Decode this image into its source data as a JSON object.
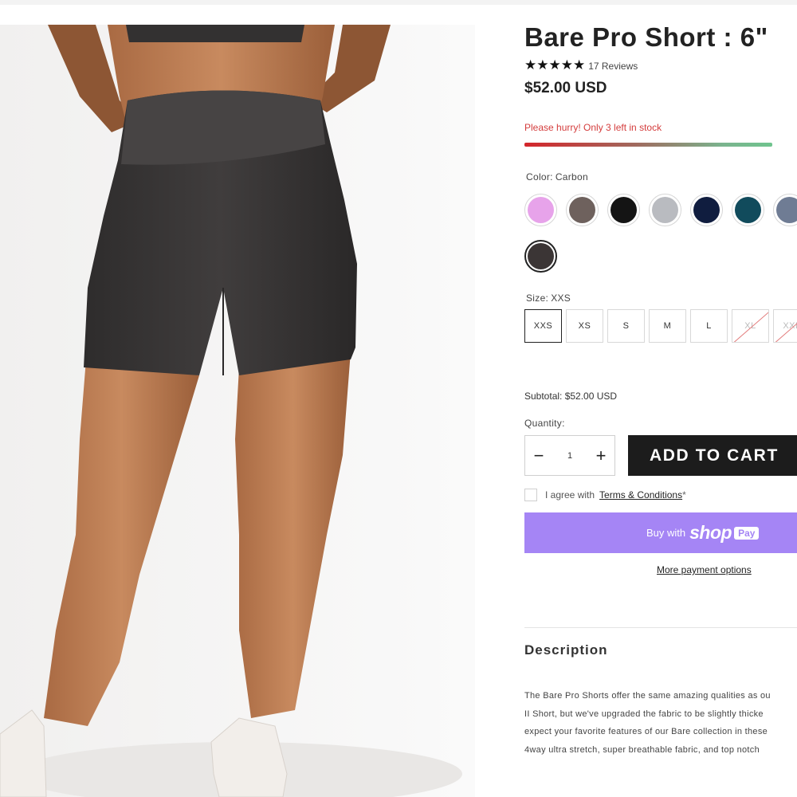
{
  "product": {
    "title": "Bare Pro Short : 6\"",
    "stars": "★★★★★",
    "reviews": "17 Reviews",
    "price": "$52.00 USD",
    "stock_message": "Please hurry! Only 3 left in stock",
    "stock_fraction": 0.6
  },
  "color": {
    "label": "Color:",
    "selected": "Carbon",
    "swatches": [
      {
        "name": "pink",
        "hex": "#e7a3ea"
      },
      {
        "name": "mocha",
        "hex": "#6e615d"
      },
      {
        "name": "black",
        "hex": "#141414"
      },
      {
        "name": "light-grey",
        "hex": "#b9bbc0"
      },
      {
        "name": "navy",
        "hex": "#101d3f"
      },
      {
        "name": "teal",
        "hex": "#114b5c"
      },
      {
        "name": "slate-blue",
        "hex": "#6f7c94"
      },
      {
        "name": "carbon",
        "hex": "#3b3535",
        "selected": true
      }
    ]
  },
  "size": {
    "label": "Size:",
    "selected": "XXS",
    "options": [
      {
        "label": "XXS",
        "selected": true,
        "sold_out": false
      },
      {
        "label": "XS",
        "selected": false,
        "sold_out": false
      },
      {
        "label": "S",
        "selected": false,
        "sold_out": false
      },
      {
        "label": "M",
        "selected": false,
        "sold_out": false
      },
      {
        "label": "L",
        "selected": false,
        "sold_out": false
      },
      {
        "label": "XL",
        "selected": false,
        "sold_out": true
      },
      {
        "label": "XXL",
        "selected": false,
        "sold_out": true
      }
    ]
  },
  "subtotal": "Subtotal: $52.00 USD",
  "quantity": {
    "label": "Quantity:",
    "value": "1",
    "minus": "−",
    "plus": "+"
  },
  "add_to_cart": "ADD TO CART",
  "agree": {
    "text": "I agree with",
    "terms": "Terms & Conditions",
    "asterisk": "*"
  },
  "shop_pay": {
    "buy_with": "Buy with",
    "brand": "shop",
    "pay": "Pay",
    "color": "#a585f5"
  },
  "more_payment": "More payment options",
  "description": {
    "title": "Description",
    "lines": [
      "The Bare Pro Shorts offer the same amazing qualities as ou",
      "II Short, but we've upgraded the fabric to be slightly thicke",
      "expect your favorite features of our Bare collection in these",
      "4way ultra stretch, super breathable fabric, and top notch"
    ]
  },
  "accent_colors": {
    "stock_red": "#d43c3c",
    "button_dark": "#1c1c1c",
    "short_fabric": "#3a3838"
  }
}
